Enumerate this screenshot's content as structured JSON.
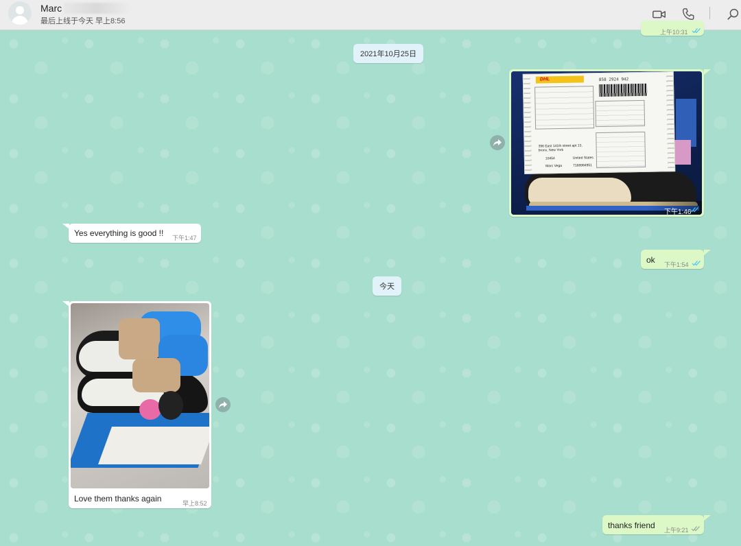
{
  "header": {
    "contact_name": "Marc Ve",
    "last_seen": "最后上线于今天 早上8:56"
  },
  "icons": [
    "video-call-icon",
    "voice-call-icon",
    "search-icon",
    "forward-icon",
    "read-receipt-icon"
  ],
  "chat": {
    "top_partial_time": "上午10:31",
    "date_chip_1": "2021年10月25日",
    "msg_shipping_photo": {
      "time": "下午1:46",
      "label": {
        "tracking": "858 2924 942",
        "address": "396 East 141th street apt 13, bronx, New York",
        "zip": "10454",
        "country": "United States",
        "name": "Marc Vega",
        "phone": "7188984951"
      }
    },
    "msg_everything_good": {
      "text": "Yes everything is good !!",
      "time": "下午1:47"
    },
    "msg_ok": {
      "text": "ok",
      "time": "下午1:54"
    },
    "date_chip_2": "今天",
    "msg_sneaker_photo": {
      "caption": "Love them thanks again",
      "time": "早上8:52"
    },
    "msg_thanks_friend": {
      "text": "thanks friend",
      "time": "上午9:21"
    }
  },
  "colors": {
    "outgoing_bubble": "#dcf8c6",
    "incoming_bubble": "#ffffff",
    "chat_background": "#a6ddcc",
    "read_tick": "#4fc3f7"
  }
}
